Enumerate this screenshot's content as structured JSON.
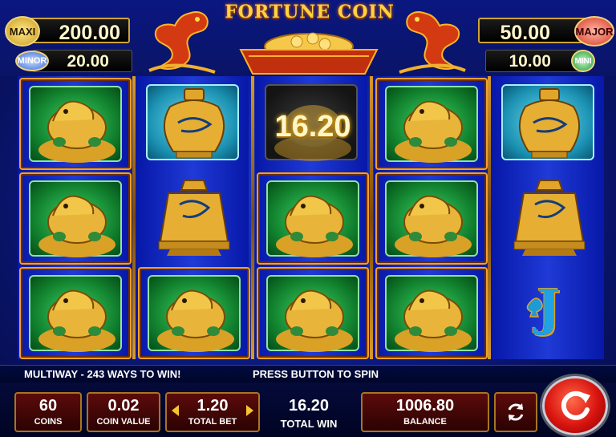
{
  "game": {
    "title": "FORTUNE COIN"
  },
  "jackpots": {
    "maxi": {
      "label": "MAXI",
      "value": "200.00"
    },
    "minor": {
      "label": "MINOR",
      "value": "20.00"
    },
    "major": {
      "label": "MAJOR",
      "value": "50.00"
    },
    "mini": {
      "label": "MINI",
      "value": "10.00"
    }
  },
  "reels": {
    "win_value": "16.20",
    "grid": [
      [
        "turtle",
        "turtle",
        "turtle"
      ],
      [
        "vase",
        "bell",
        "turtle"
      ],
      [
        "turtle-win",
        "turtle",
        "turtle"
      ],
      [
        "turtle",
        "turtle",
        "turtle"
      ],
      [
        "vase",
        "bell",
        "J"
      ]
    ],
    "letter_symbol": "J"
  },
  "messages": {
    "left": "MULTIWAY - 243 WAYS TO WIN!",
    "center": "PRESS BUTTON TO SPIN"
  },
  "controls": {
    "coins": {
      "value": "60",
      "label": "COINS"
    },
    "coin_value": {
      "value": "0.02",
      "label": "COIN VALUE"
    },
    "total_bet": {
      "value": "1.20",
      "label": "TOTAL BET"
    },
    "total_win": {
      "value": "16.20",
      "label": "TOTAL WIN"
    },
    "balance": {
      "value": "1006.80",
      "label": "BALANCE"
    }
  },
  "colors": {
    "background": "#0c1b86",
    "frame_gold": "#f1a02b",
    "panel_red": "#5c0b0b",
    "spin_red": "#d8130e",
    "symbol_gold": "#e0a52a"
  },
  "icons": {
    "autoplay": "autoplay-arrows-icon",
    "spin": "spin-circular-arrow-icon"
  }
}
